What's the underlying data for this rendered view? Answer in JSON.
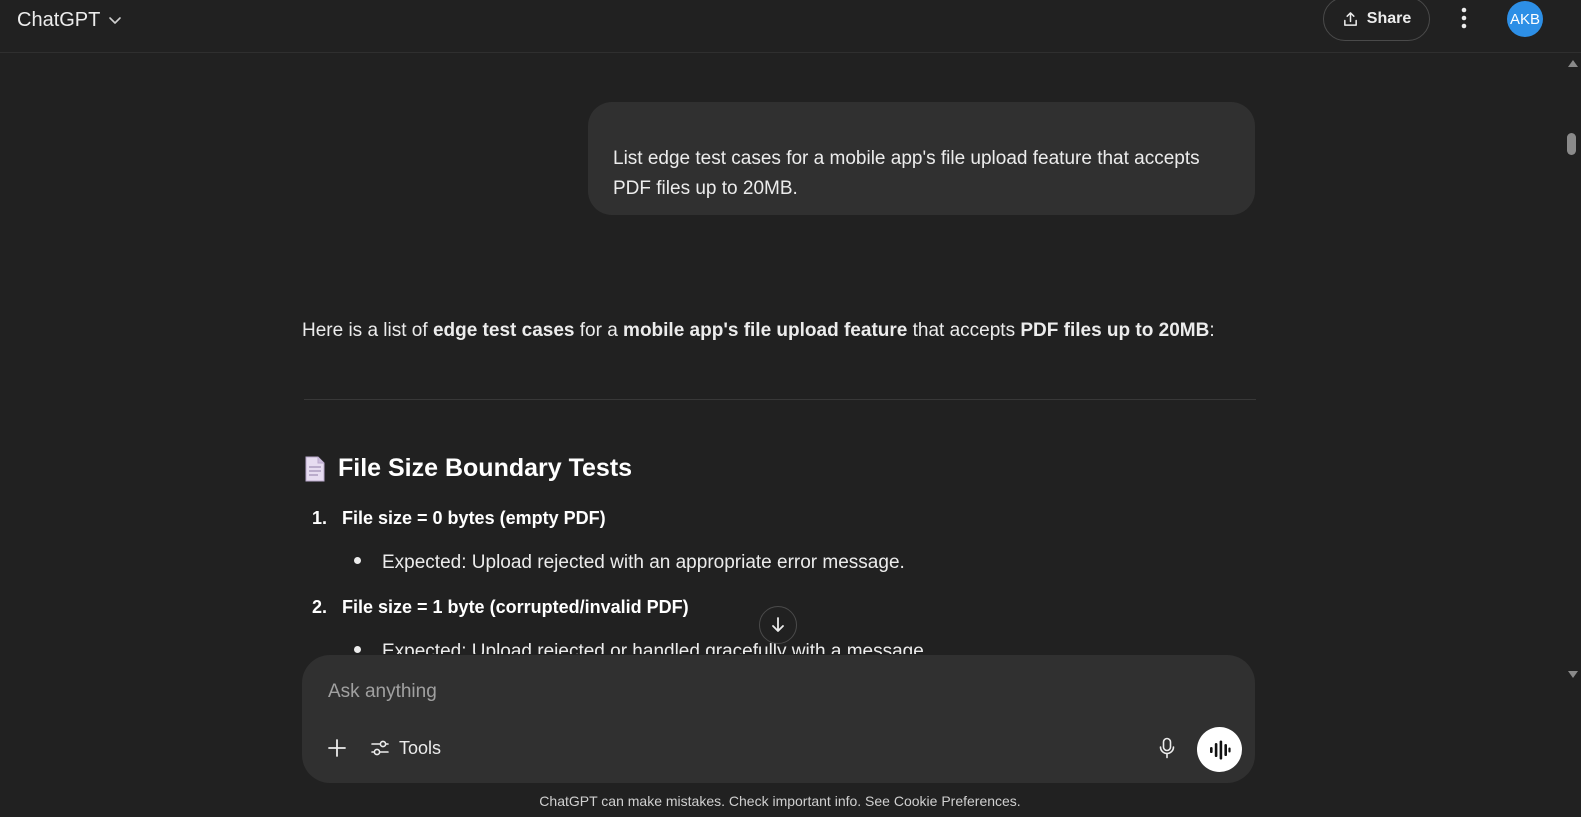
{
  "header": {
    "model_name": "ChatGPT",
    "share_label": "Share",
    "avatar_initials": "AKB"
  },
  "conversation": {
    "user_message": "List edge test cases for a mobile app's file upload feature that accepts PDF files up to 20MB.",
    "assistant": {
      "intro": {
        "t1": "Here is a list of ",
        "b1": "edge test cases",
        "t2": " for a ",
        "b2": "mobile app's file upload feature",
        "t3": " that accepts ",
        "b3": "PDF files up to 20MB",
        "t4": ":"
      },
      "section_title": "File Size Boundary Tests",
      "items": [
        {
          "number": "1.",
          "title": "File size = 0 bytes (empty PDF)",
          "bullet": "Expected: Upload rejected with an appropriate error message."
        },
        {
          "number": "2.",
          "title": "File size = 1 byte (corrupted/invalid PDF)",
          "bullet": "Expected: Upload rejected or handled gracefully with a message."
        }
      ]
    }
  },
  "composer": {
    "placeholder": "Ask anything",
    "tools_label": "Tools"
  },
  "footer": {
    "note": "ChatGPT can make mistakes. Check important info. See Cookie Preferences."
  },
  "icons": {
    "chevron": "chevron-down-icon",
    "share": "share-upload-icon",
    "more": "more-vertical-icon",
    "doc": "page-document-icon",
    "scroll": "arrow-down-icon",
    "plus": "plus-icon",
    "tools": "sliders-icon",
    "mic": "microphone-icon",
    "voice": "voice-wave-icon"
  },
  "colors": {
    "background": "#212121",
    "bubble": "#303030",
    "avatar": "#2d8fe6"
  }
}
